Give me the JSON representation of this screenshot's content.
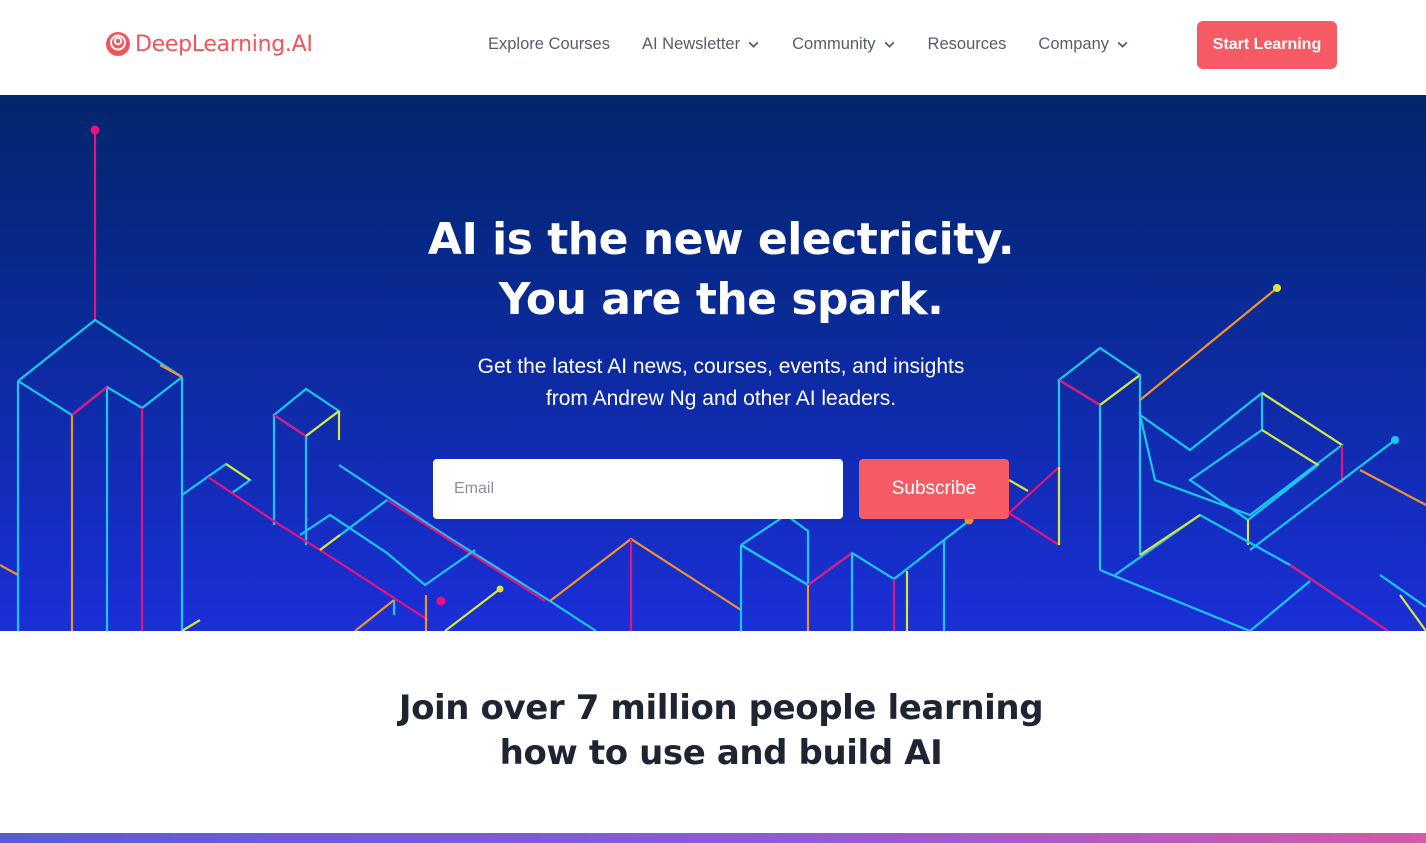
{
  "header": {
    "logo_text": "DeepLearning.AI",
    "logo_icon": "deeplearning-logo-icon",
    "nav": [
      {
        "label": "Explore Courses",
        "dropdown": false
      },
      {
        "label": "AI Newsletter",
        "dropdown": true
      },
      {
        "label": "Community",
        "dropdown": true
      },
      {
        "label": "Resources",
        "dropdown": false
      },
      {
        "label": "Company",
        "dropdown": true
      }
    ],
    "cta_label": "Start Learning"
  },
  "hero": {
    "title_line1": "AI is the new electricity.",
    "title_line2": "You are the spark.",
    "subtitle_line1": "Get the latest AI news, courses, events, and insights",
    "subtitle_line2": "from Andrew Ng and other AI leaders.",
    "email_placeholder": "Email",
    "subscribe_label": "Subscribe"
  },
  "join": {
    "line1": "Join over 7 million people learning",
    "line2": "how to use and build AI"
  },
  "colors": {
    "brand": "#f65b65",
    "hero_top": "#01266b",
    "hero_bottom": "#1a2fd8",
    "line_cyan": "#19c8f0",
    "line_magenta": "#e8127e",
    "line_yellow": "#d8e63a",
    "line_orange": "#f0932a"
  }
}
